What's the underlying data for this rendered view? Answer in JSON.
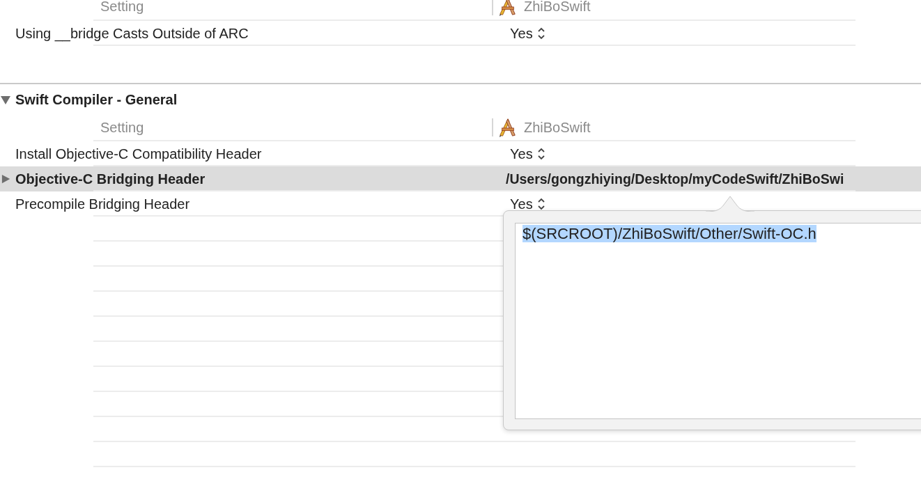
{
  "sections": [
    {
      "header": {
        "setting_label": "Setting",
        "target_name": "ZhiBoSwift"
      },
      "rows": [
        {
          "name": "Using __bridge Casts Outside of ARC",
          "value": "Yes",
          "kind": "popup",
          "selected": false
        }
      ]
    },
    {
      "title": "Swift Compiler - General",
      "expanded": true,
      "header": {
        "setting_label": "Setting",
        "target_name": "ZhiBoSwift"
      },
      "rows": [
        {
          "name": "Install Objective-C Compatibility Header",
          "value": "Yes",
          "kind": "popup",
          "selected": false
        },
        {
          "name": "Objective-C Bridging Header",
          "value": "/Users/gongzhiying/Desktop/myCodeSwift/ZhiBoSwi",
          "kind": "expandable",
          "expanded": false,
          "selected": true
        },
        {
          "name": "Precompile Bridging Header",
          "value": "Yes",
          "kind": "popup",
          "selected": false
        }
      ]
    }
  ],
  "editor_popover": {
    "value": "$(SRCROOT)/ZhiBoSwift/Other/Swift-OC.h",
    "text_selected": true
  }
}
